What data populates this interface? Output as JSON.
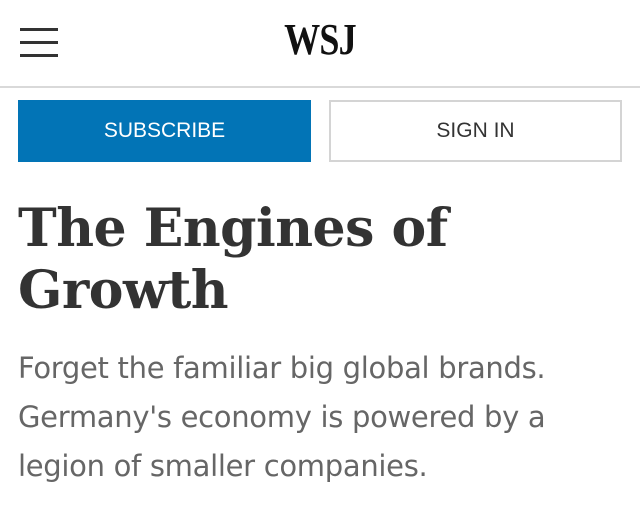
{
  "header": {
    "logo": "WSJ",
    "menu_icon": "hamburger-menu-icon"
  },
  "actions": {
    "subscribe_label": "SUBSCRIBE",
    "sign_in_label": "SIGN IN"
  },
  "article": {
    "headline": "The Engines of Growth",
    "dek": "Forget the familiar big global brands. Germany's economy is powered by a legion of smaller companies."
  },
  "colors": {
    "subscribe_bg": "#0274b6",
    "headline_text": "#333333",
    "dek_text": "#666666"
  }
}
